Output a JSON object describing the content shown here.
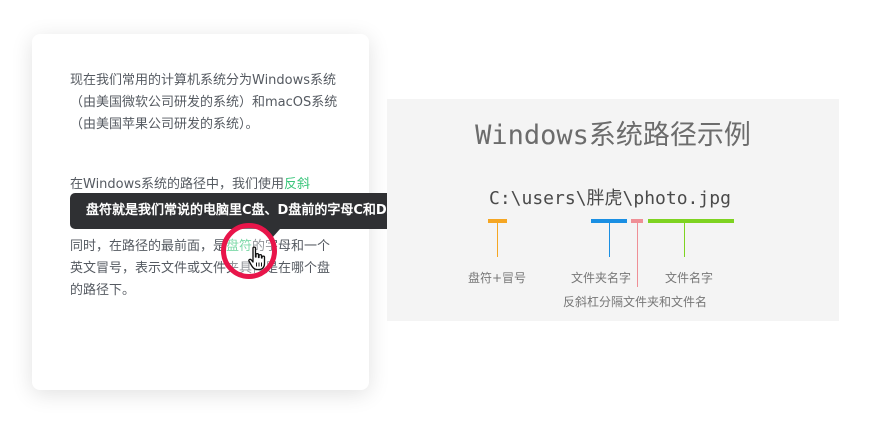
{
  "article": {
    "p1": "现在我们常用的计算机系统分为Windows系统（由美国微软公司研发的系统）和macOS系统（由美国苹果公司研发的系统）。",
    "p2_before": "在Windows系统的路径中，我们使用",
    "p2_link": "反斜",
    "p3_before": "同时，在路径的最前面，是",
    "p3_link": "盘符",
    "p3_after": "的字母和一个英文冒号，表示文件或文件夹具体是在哪个盘的路径下。"
  },
  "tooltip": {
    "text": "盘符就是我们常说的电脑里C盘、D盘前的字母C和D。"
  },
  "diagram": {
    "title": "Windows系统路径示例",
    "path": "C:\\users\\胖虎\\photo.jpg",
    "labels": {
      "drive": "盘符+冒号",
      "folder": "文件夹名字",
      "file": "文件名字",
      "backslash": "反斜杠分隔文件夹和文件名"
    },
    "colors": {
      "drive": "#f5a623",
      "folder": "#1a8fe3",
      "backslash": "#ef8f96",
      "file": "#7ed321"
    }
  },
  "colors": {
    "link": "#38c57a",
    "ring": "#e8154a",
    "tooltip_bg": "#2f3033"
  }
}
